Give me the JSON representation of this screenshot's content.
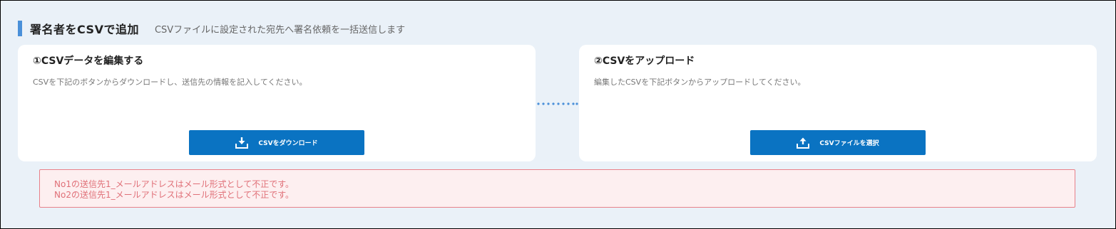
{
  "header": {
    "title": "署名者をCSVで追加",
    "description": "CSVファイルに設定された宛先へ署名依頼を一括送信します"
  },
  "steps": [
    {
      "title": "①CSVデータを編集する",
      "description": "CSVを下記のボタンからダウンロードし、送信先の情報を記入してください。",
      "button_label": "CSVをダウンロード",
      "button_icon": "download-icon"
    },
    {
      "title": "②CSVをアップロード",
      "description": "編集したCSVを下記ボタンからアップロードしてください。",
      "button_label": "CSVファイルを選択",
      "button_icon": "upload-icon"
    }
  ],
  "errors": [
    "No1の送信先1_メールアドレスはメール形式として不正です。",
    "No2の送信先1_メールアドレスはメール形式として不正です。"
  ],
  "colors": {
    "accent": "#4a90d9",
    "button": "#0a73c2",
    "error_text": "#e07078",
    "error_border": "#e8818a",
    "error_background": "#fdeff0",
    "panel_background": "#eaf1f8"
  }
}
